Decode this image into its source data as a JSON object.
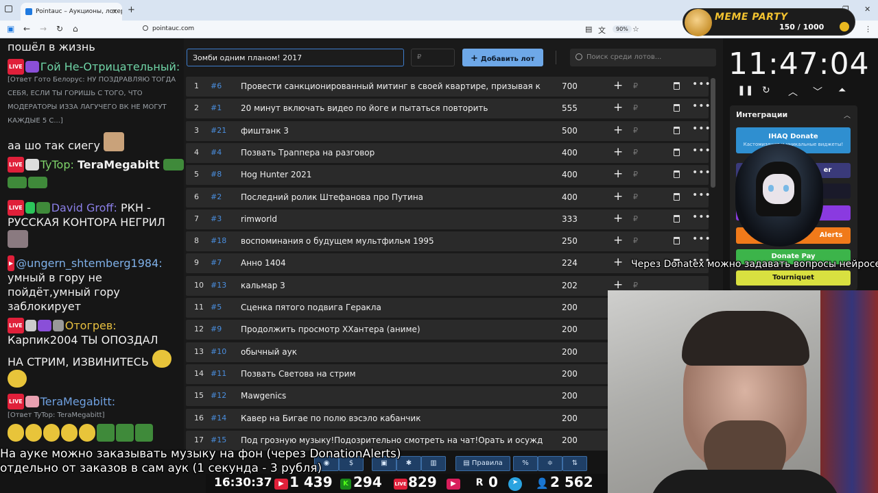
{
  "browser": {
    "tab_title": "Pointauc – Аукционы, лотереи",
    "tab_close": "×",
    "new_tab": "+",
    "url": "pointauc.com",
    "zoom": "90%",
    "win_min": "—",
    "win_max": "❐",
    "win_close": "✕",
    "back": "←",
    "forward": "→",
    "reload": "↻",
    "home": "⌂",
    "menu": "⋮"
  },
  "meme_party": {
    "title": "MEME PARTY",
    "score": "150 / 1000"
  },
  "chat": {
    "messages": [
      {
        "text": "пошёл в жизнь"
      },
      {
        "nick": "Гой Не-Отрицательный:",
        "nick_color": "#6fd4a6"
      },
      {
        "reply": "[Ответ Гото Белорус: НУ ПОЗДРАВЛЯЮ ТОГДА"
      },
      {
        "reply": "СЕБЯ, ЕСЛИ ТЫ ГОРИШЬ С ТОГО, ЧТО"
      },
      {
        "reply": "МОДЕРАТОРЫ ИЗЗА ЛАГУЧЕГО ВК НЕ МОГУТ"
      },
      {
        "reply": "КАЖДЫЕ 5 С...]"
      },
      {
        "text": "аа шо так сиегу"
      },
      {
        "nick": "TyTop:",
        "nick_color": "#7fd46a",
        "text": "TeraMegabitt"
      },
      {
        "nick": "David Groff:",
        "nick_color": "#8b7fe8",
        "text": "РКН -"
      },
      {
        "text": "РУССКАЯ КОНТОРА НЕГРИЛ"
      },
      {
        "nick": "@ungern_shtemberg1984:",
        "nick_color": "#7fb0e8"
      },
      {
        "text": "умный в гору не"
      },
      {
        "text": "пойдёт,умный гору"
      },
      {
        "text": "заблокирует"
      },
      {
        "nick": "Отогрев:",
        "nick_color": "#e8c040"
      },
      {
        "text": "Карпик2004  ТЫ ОПОЗДАЛ"
      },
      {
        "text": "НА СТРИМ, ИЗВИНИТЕСЬ"
      },
      {
        "nick": "TeraMegabitt:",
        "nick_color": "#6fa0e0"
      },
      {
        "reply": "[Ответ TyTop: TeraMegabitt]"
      }
    ],
    "live_label": "LIVE"
  },
  "auction": {
    "lot_input_value": "Зомби одним планом! 2017",
    "price_placeholder": "₽",
    "add_button": "Добавить лот",
    "search_placeholder": "Поиск среди лотов...",
    "currency": "₽",
    "plus": "+",
    "more": "•••",
    "lots": [
      {
        "n": "1",
        "id": "#6",
        "title": "Провести санкционированный митинг в своей квартире, призывая к блоки",
        "amount": "700"
      },
      {
        "n": "2",
        "id": "#1",
        "title": "20 минут включать видео по йоге и пытаться повторить",
        "amount": "555"
      },
      {
        "n": "3",
        "id": "#21",
        "title": "фиштанк 3",
        "amount": "500"
      },
      {
        "n": "4",
        "id": "#4",
        "title": "Позвать Траппера на разговор",
        "amount": "400"
      },
      {
        "n": "5",
        "id": "#8",
        "title": "Hog Hunter 2021",
        "amount": "400"
      },
      {
        "n": "6",
        "id": "#2",
        "title": "Последний ролик Штефанова про Путина",
        "amount": "400"
      },
      {
        "n": "7",
        "id": "#3",
        "title": "rimworld",
        "amount": "333"
      },
      {
        "n": "8",
        "id": "#18",
        "title": "воспоминания о будущем мультфильм 1995",
        "amount": "250"
      },
      {
        "n": "9",
        "id": "#7",
        "title": "Анно 1404",
        "amount": "224"
      },
      {
        "n": "10",
        "id": "#13",
        "title": "кальмар 3",
        "amount": "202"
      },
      {
        "n": "11",
        "id": "#5",
        "title": "Сценка пятого подвига Геракла",
        "amount": "200"
      },
      {
        "n": "12",
        "id": "#9",
        "title": "Продолжить просмотр ХХантера (аниме)",
        "amount": "200"
      },
      {
        "n": "13",
        "id": "#10",
        "title": "обычный аук",
        "amount": "200"
      },
      {
        "n": "14",
        "id": "#11",
        "title": "Позвать Светова на стрим",
        "amount": "200"
      },
      {
        "n": "15",
        "id": "#12",
        "title": "Mawgenics",
        "amount": "200"
      },
      {
        "n": "16",
        "id": "#14",
        "title": "Кавер на Бигае по полю вэсэло кабанчик",
        "amount": "200"
      },
      {
        "n": "17",
        "id": "#15",
        "title": "Под грозную музыку!Подозрительно смотреть на чат!Орать и осуждать ча",
        "amount": "200"
      }
    ]
  },
  "timer": {
    "time": "11:47:04",
    "controls": [
      "❚❚",
      "↻",
      "︿",
      "﹀",
      "⏶"
    ]
  },
  "integrations": {
    "title": "Интеграции",
    "chevron": "︿",
    "ihaq": "IHAQ Donate",
    "ihaq_sub": "Кастомизация и уникальные виджеты!",
    "er": "er",
    "alerts": "Alerts",
    "donatepay": "Donate Pay",
    "tourniquet": "Tourniquet"
  },
  "captions": {
    "donatex": "Через Donatex можно задавать вопросы нейросети",
    "music_line1": "На ауке можно заказывать музыку на фон (через DonationAlerts)",
    "music_line2": "отдельно от заказов в сам аук (1 секунда - 3 рубля)"
  },
  "toolbar": {
    "rules": "Правила",
    "percent": "%",
    "dollar": "$"
  },
  "stats": {
    "time": "16:30:37",
    "youtube": "1 439",
    "kick": "294",
    "vklive": "829",
    "rutube": "0",
    "viewers": "2 562",
    "kick_label": "K",
    "r_label": "R",
    "live_label": "LIVE"
  },
  "colors": {
    "accent_blue": "#6ea8e8",
    "lot_id": "#4a8fe0",
    "live_red": "#e0203a",
    "kick_green": "#53fc18"
  }
}
